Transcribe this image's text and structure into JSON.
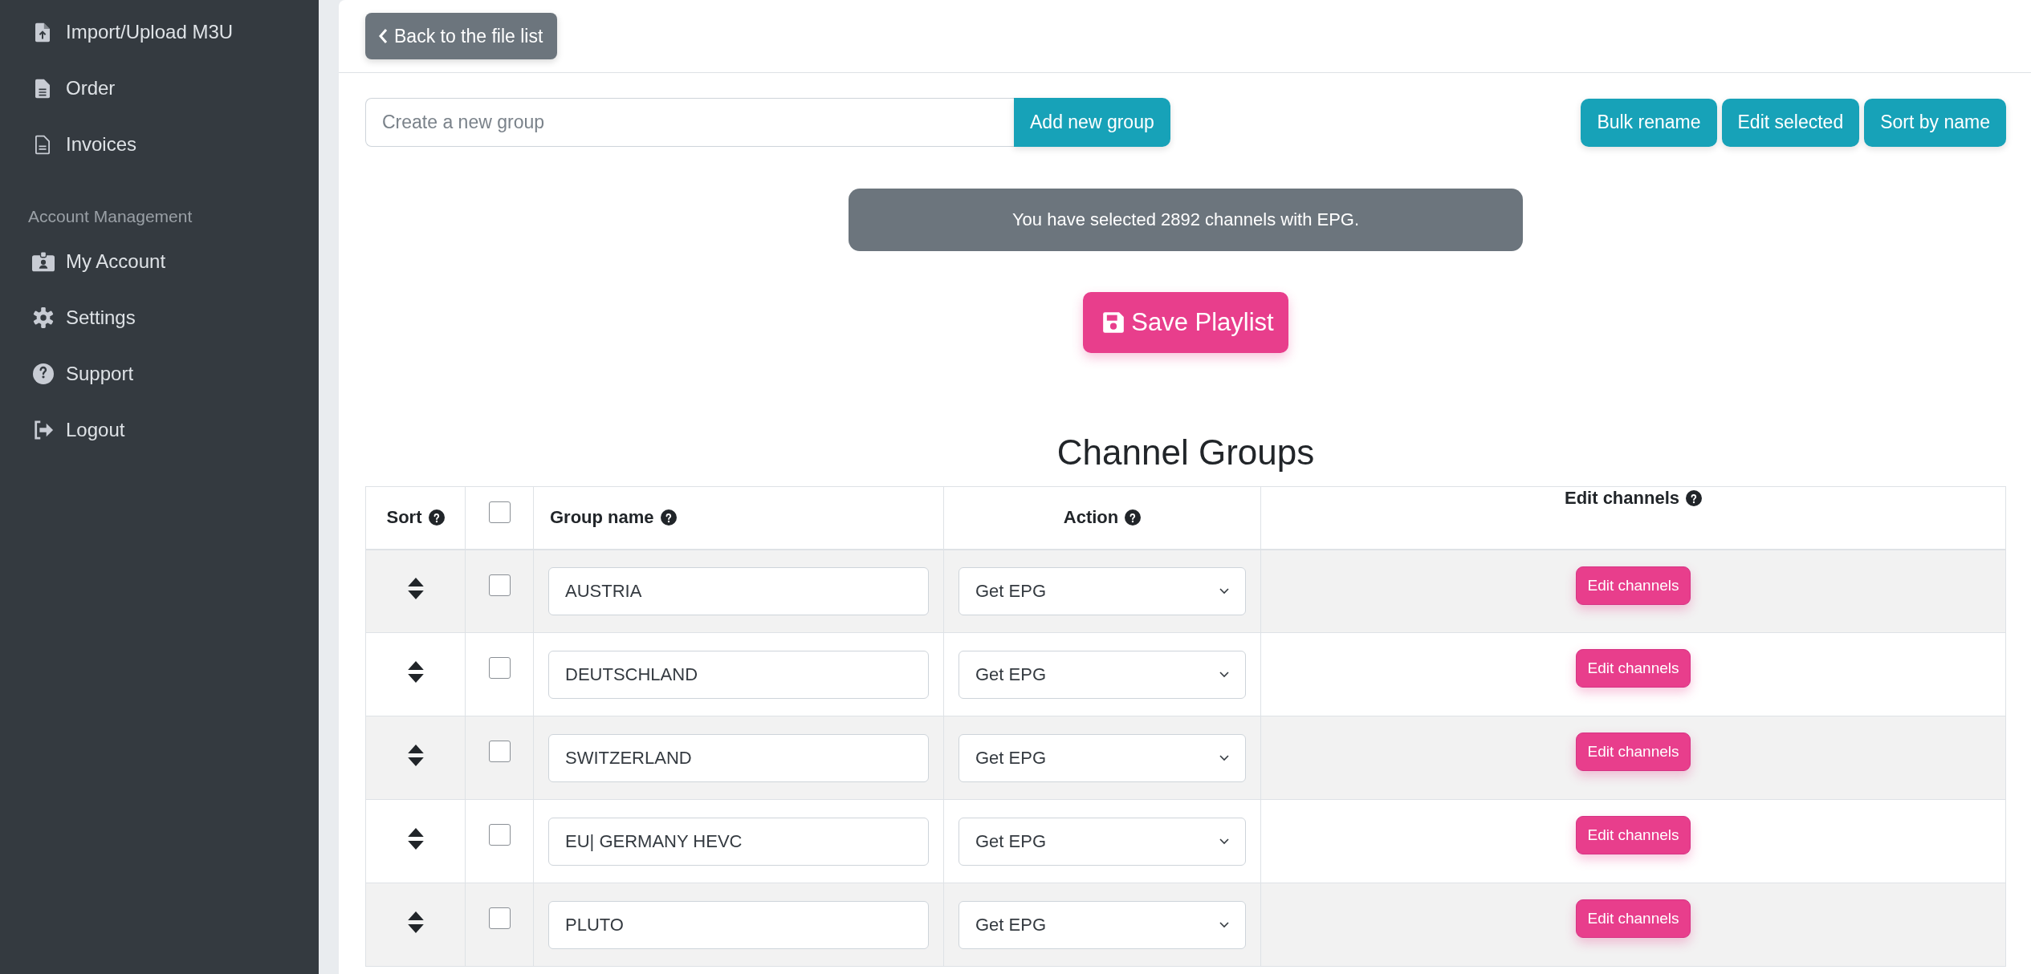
{
  "sidebar": {
    "items": [
      {
        "label": "Import/Upload M3U"
      },
      {
        "label": "Order"
      },
      {
        "label": "Invoices"
      }
    ],
    "section_title": "Account Management",
    "account_items": [
      {
        "label": "My Account"
      },
      {
        "label": "Settings"
      },
      {
        "label": "Support"
      },
      {
        "label": "Logout"
      }
    ]
  },
  "back_button": "Back to the file list",
  "new_group": {
    "placeholder": "Create a new group",
    "button": "Add new group"
  },
  "toolbar_buttons": [
    "Bulk rename",
    "Edit selected",
    "Sort by name"
  ],
  "info_message": "You have selected 2892 channels with EPG.",
  "save_button": "Save Playlist",
  "title": "Channel Groups",
  "table": {
    "columns": [
      {
        "label": "Sort",
        "kind": "text"
      },
      {
        "kind": "checkbox",
        "checked": false
      },
      {
        "label": "Group name",
        "kind": "text"
      },
      {
        "label": "Action",
        "kind": "text"
      },
      {
        "label": "Edit channels",
        "kind": "text"
      }
    ],
    "rows": [
      {
        "checked": false,
        "group_name": "AUSTRIA",
        "action": "Get EPG",
        "button": "Edit channels"
      },
      {
        "checked": false,
        "group_name": "DEUTSCHLAND",
        "action": "Get EPG",
        "button": "Edit channels"
      },
      {
        "checked": false,
        "group_name": "SWITZERLAND",
        "action": "Get EPG",
        "button": "Edit channels"
      },
      {
        "checked": false,
        "group_name": "EU| GERMANY HEVC",
        "action": "Get EPG",
        "button": "Edit channels"
      },
      {
        "checked": false,
        "group_name": "PLUTO",
        "action": "Get EPG",
        "button": "Edit channels"
      }
    ]
  }
}
